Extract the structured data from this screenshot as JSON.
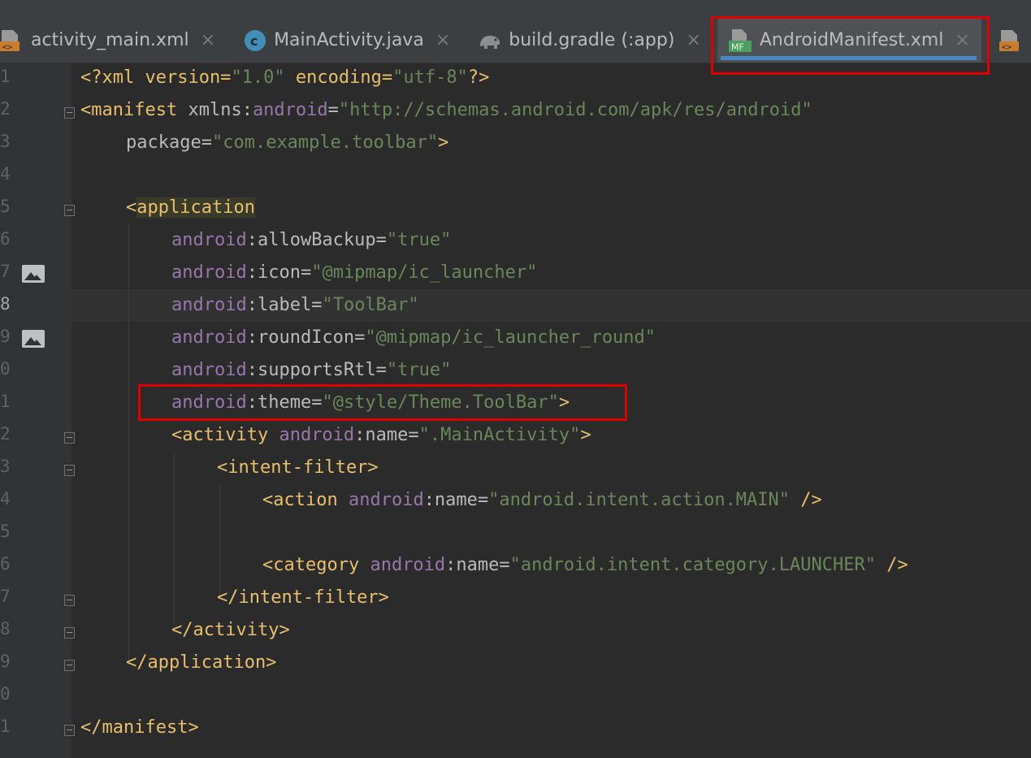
{
  "tabs": [
    {
      "label": "activity_main.xml",
      "icon": "xml-file-icon",
      "active": false
    },
    {
      "label": "MainActivity.java",
      "icon": "java-class-icon",
      "active": false
    },
    {
      "label": "build.gradle (:app)",
      "icon": "gradle-elephant-icon",
      "active": false
    },
    {
      "label": "AndroidManifest.xml",
      "icon": "manifest-file-icon",
      "active": true
    },
    {
      "label": "",
      "icon": "xml-file-icon",
      "active": false
    }
  ],
  "close_glyph": "×",
  "line_numbers": [
    "1",
    "2",
    "3",
    "4",
    "5",
    "6",
    "7",
    "8",
    "9",
    "0",
    "1",
    "2",
    "3",
    "4",
    "5",
    "6",
    "7",
    "8",
    "9",
    "0",
    "1"
  ],
  "code": {
    "l1": [
      "<?xml version=",
      "\"1.0\"",
      " encoding=",
      "\"utf-8\"",
      "?>"
    ],
    "l2": [
      "<manifest",
      " xmlns:",
      "android",
      "=",
      "\"http://schemas.android.com/apk/res/android\""
    ],
    "l3": [
      "package",
      "=",
      "\"com.example.toolbar\"",
      ">"
    ],
    "l5": [
      "<",
      "application"
    ],
    "l6": [
      "android",
      ":allowBackup",
      "=",
      "\"true\""
    ],
    "l7": [
      "android",
      ":icon",
      "=",
      "\"@mipmap/ic_launcher\""
    ],
    "l8": [
      "android",
      ":label",
      "=",
      "\"ToolBar\""
    ],
    "l9": [
      "android",
      ":roundIcon",
      "=",
      "\"@mipmap/ic_launcher_round\""
    ],
    "l10": [
      "android",
      ":supportsRtl",
      "=",
      "\"true\""
    ],
    "l11": [
      "android",
      ":theme",
      "=",
      "\"@style/Theme.ToolBar\"",
      ">"
    ],
    "l12": [
      "<activity ",
      "android",
      ":name",
      "=",
      "\".MainActivity\"",
      ">"
    ],
    "l13": [
      "<intent-filter>"
    ],
    "l14": [
      "<action ",
      "android",
      ":name",
      "=",
      "\"android.intent.action.MAIN\"",
      " />"
    ],
    "l16": [
      "<category ",
      "android",
      ":name",
      "=",
      "\"android.intent.category.LAUNCHER\"",
      " />"
    ],
    "l17": [
      "</intent-filter>"
    ],
    "l18": [
      "</activity>"
    ],
    "l19": [
      "</application>"
    ],
    "l21": [
      "</manifest>"
    ]
  },
  "colors": {
    "tag": "#e8bf6a",
    "namespace": "#9876aa",
    "string": "#6a8759",
    "attribute": "#bababa",
    "highlight_box": "#e00000",
    "active_tab_underline": "#4a88c7"
  }
}
